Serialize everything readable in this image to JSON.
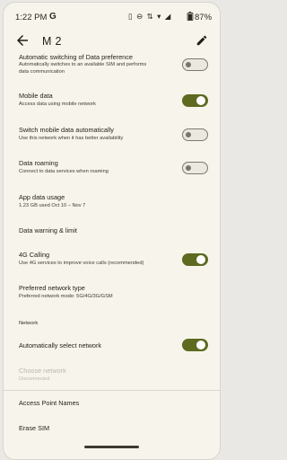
{
  "status_bar": {
    "time": "1:22 PM",
    "carrier_glyph": "G",
    "battery": "87%",
    "icons": [
      "vibrate-icon",
      "dnd-icon",
      "data-icon",
      "wifi-icon",
      "signal-icon",
      "battery-icon"
    ]
  },
  "toolbar": {
    "title": "M 2",
    "back_icon": "back-arrow-icon",
    "edit_icon": "pencil-icon"
  },
  "settings": {
    "data_pref": {
      "title": "Automatic switching of Data preference",
      "subtitle_line1": "Automatically switches to an available SIM and performs",
      "subtitle_line2": "data communication",
      "enabled": false
    },
    "mobile_data": {
      "title": "Mobile data",
      "subtitle": "Access data using mobile network",
      "enabled": true
    },
    "switch_auto": {
      "title": "Switch mobile data automatically",
      "subtitle": "Use this network when it has better availability",
      "enabled": false
    },
    "roaming": {
      "title": "Data roaming",
      "subtitle": "Connect to data services when roaming",
      "enabled": false
    },
    "app_data_usage": {
      "title": "App data usage",
      "subtitle": "1.23 GB used Oct 10 – Nov 7"
    },
    "data_warning": {
      "title": "Data warning & limit"
    },
    "calling_4g": {
      "title": "4G Calling",
      "subtitle": "Use 4G services to improve voice calls (recommended)",
      "enabled": true
    },
    "preferred_network": {
      "title": "Preferred network type",
      "subtitle": "Preferred network mode: 5G/4G/3G/GSM"
    },
    "network_header": "Network",
    "auto_select": {
      "title": "Automatically select network",
      "enabled": true
    },
    "choose_network": {
      "title": "Choose network",
      "subtitle": "Disconnected"
    },
    "apn": {
      "title": "Access Point Names"
    },
    "erase_sim": {
      "title": "Erase SIM"
    }
  },
  "colors": {
    "background": "#f7f5eb",
    "switch_on": "#5d6a20",
    "switch_off_border": "#7b7a71"
  }
}
